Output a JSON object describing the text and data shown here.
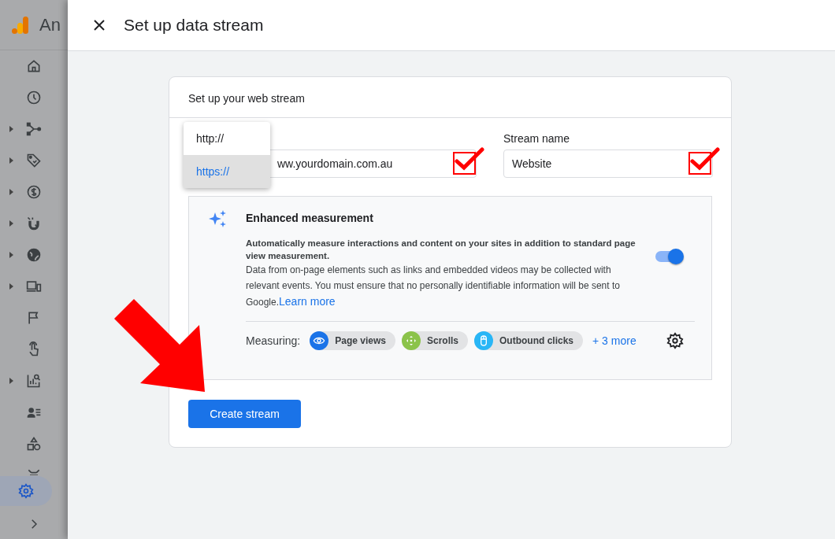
{
  "app": {
    "title": "An"
  },
  "nav": [
    {
      "expandable": false
    },
    {
      "expandable": false
    },
    {
      "expandable": true
    },
    {
      "expandable": true
    },
    {
      "expandable": true
    },
    {
      "expandable": true
    },
    {
      "expandable": true
    },
    {
      "expandable": true
    },
    {
      "expandable": false
    },
    {
      "expandable": false
    },
    {
      "expandable": true
    },
    {
      "expandable": false
    },
    {
      "expandable": false
    },
    {
      "expandable": false
    }
  ],
  "nav_settings": {
    "selected": true
  },
  "dialog": {
    "title": "Set up data stream"
  },
  "card": {
    "title": "Set up your web stream"
  },
  "protocol_menu": [
    {
      "label": "http://",
      "selected": false
    },
    {
      "label": "https://",
      "selected": true
    }
  ],
  "url_field": {
    "value": "ww.yourdomain.com.au"
  },
  "stream_name": {
    "label": "Stream name",
    "value": "Website"
  },
  "enhanced": {
    "title": "Enhanced measurement",
    "lead": "Automatically measure interactions and content on your sites in addition to standard page view measurement.",
    "body": "Data from on-page elements such as links and embedded videos may be collected with relevant events. You must ensure that no personally identifiable information will be sent to Google.",
    "link": "Learn more",
    "on": true,
    "measuring_label": "Measuring:",
    "chips": [
      {
        "label": "Page views",
        "color": "#1a73e8"
      },
      {
        "label": "Scrolls",
        "color": "#8bc34a"
      },
      {
        "label": "Outbound clicks",
        "color": "#29b6f6"
      }
    ],
    "more": "+ 3 more"
  },
  "create_button": "Create stream"
}
